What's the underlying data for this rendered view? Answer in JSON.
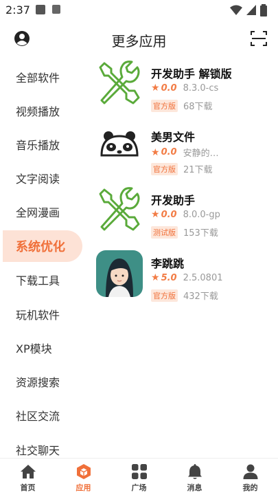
{
  "status_bar": {
    "time": "2:37"
  },
  "header": {
    "title": "更多应用"
  },
  "sidebar": {
    "items": [
      {
        "label": "全部软件",
        "active": false
      },
      {
        "label": "视频播放",
        "active": false
      },
      {
        "label": "音乐播放",
        "active": false
      },
      {
        "label": "文字阅读",
        "active": false
      },
      {
        "label": "全网漫画",
        "active": false
      },
      {
        "label": "系统优化",
        "active": true
      },
      {
        "label": "下载工具",
        "active": false
      },
      {
        "label": "玩机软件",
        "active": false
      },
      {
        "label": "XP模块",
        "active": false
      },
      {
        "label": "资源搜索",
        "active": false
      },
      {
        "label": "社区交流",
        "active": false
      },
      {
        "label": "社交聊天",
        "active": false
      }
    ]
  },
  "apps": [
    {
      "name": "开发助手 解锁版",
      "rating": "0.0",
      "version": "8.3.0-cs",
      "tag": "官方版",
      "downloads": "68下载",
      "icon": "tools-icon"
    },
    {
      "name": "美男文件",
      "rating": "0.0",
      "version": "安静的…",
      "tag": "官方版",
      "downloads": "21下载",
      "icon": "panda-icon"
    },
    {
      "name": "开发助手",
      "rating": "0.0",
      "version": "8.0.0-gp",
      "tag": "测试版",
      "downloads": "153下载",
      "icon": "tools-icon"
    },
    {
      "name": "李跳跳",
      "rating": "5.0",
      "version": "2.5.0801",
      "tag": "官方版",
      "downloads": "432下载",
      "icon": "girl-avatar-icon"
    }
  ],
  "bottom_nav": [
    {
      "label": "首页",
      "icon": "home-icon",
      "active": false
    },
    {
      "label": "应用",
      "icon": "cube-icon",
      "active": true
    },
    {
      "label": "广场",
      "icon": "grid-icon",
      "active": false
    },
    {
      "label": "消息",
      "icon": "bell-icon",
      "active": false
    },
    {
      "label": "我的",
      "icon": "person-icon",
      "active": false
    }
  ],
  "colors": {
    "accent": "#f0703a",
    "accent_light": "#fde2d6",
    "tool_green": "#5aaa3a"
  }
}
